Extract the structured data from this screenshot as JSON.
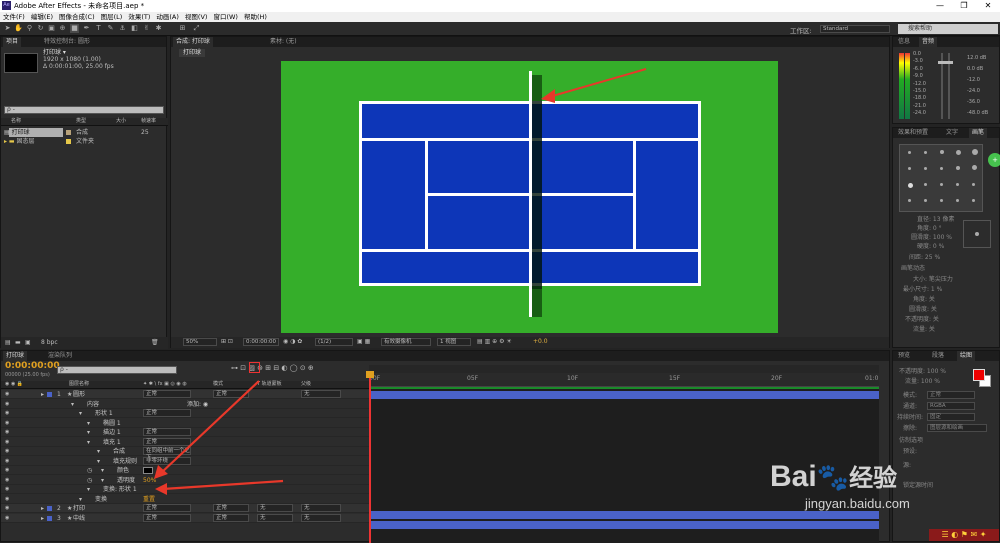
{
  "window": {
    "title": "Adobe After Effects - 未命名项目.aep *",
    "logo": "Ae",
    "min": "—",
    "max": "❐",
    "close": "✕"
  },
  "menu": [
    "文件(F)",
    "编辑(E)",
    "图像合成(C)",
    "图层(L)",
    "效果(T)",
    "动画(A)",
    "视图(V)",
    "窗口(W)",
    "帮助(H)"
  ],
  "toolbar": {
    "workspace_label": "工作区:",
    "workspace_value": "Standard",
    "search_placeholder": "搜索帮助"
  },
  "project": {
    "tabs": [
      "项目",
      "特效控制台: 圆形"
    ],
    "selected": "打印球 ▾",
    "info1": "1920 x 1080 (1.00)",
    "info2": "Δ 0:00:01:00, 25.00 fps",
    "search": "ρ -",
    "cols": [
      "名称",
      "类型",
      "大小",
      "帧速率"
    ],
    "items": [
      {
        "name": "打印球",
        "type": "合成",
        "size": "",
        "fps": "25",
        "color": "#b8a27a",
        "sel": true
      },
      {
        "name": "固态层",
        "type": "文件夹",
        "size": "",
        "fps": "",
        "color": "#e6c84a",
        "sel": false
      }
    ],
    "bpc": "8 bpc"
  },
  "comp": {
    "tabs": [
      "合成: 打印球",
      "素材: (无)"
    ],
    "subtab": "打印球",
    "zoom": "50%",
    "time": "0:00:00:00",
    "res": "(1/2)",
    "camera": "有效摄像机",
    "views": "1 视图",
    "offset": "+0.0"
  },
  "right": {
    "top_tabs": [
      "信息",
      "音频"
    ],
    "db_left": [
      "0.0",
      "-3.0",
      "-6.0",
      "-9.0",
      "-12.0",
      "-15.0",
      "-18.0",
      "-21.0",
      "-24.0"
    ],
    "db_right": [
      "12.0 dB",
      "0.0 dB",
      "-12.0",
      "-24.0",
      "-36.0",
      "-48.0 dB"
    ],
    "fx_tabs": [
      "效果和预置",
      "文字",
      "画笔"
    ],
    "brush": {
      "diameter": "直径: 13 像素",
      "angle": "角度: 0 °",
      "round": "圆滑度: 100 %",
      "hard": "硬度: 0 %",
      "spacing": "间距: 25 %",
      "dyn": "画笔动态",
      "size": "大小: 笔尖压力",
      "min": "最小尺寸: 1 %",
      "ang": "角度: 关",
      "rnd": "圆滑度: 关",
      "opa": "不透明度: 关",
      "flow": "流量: 关"
    },
    "paint_tabs": [
      "预览",
      "段落",
      "绘图"
    ],
    "paint": {
      "opacity": "不透明度: 100 %",
      "flow": "流量: 100 %",
      "mode": "模式:",
      "mode_val": "正常",
      "channel": "通道:",
      "channel_val": "RGBA",
      "dur": "持续时间:",
      "dur_val": "固定",
      "erase": "擦除:",
      "erase_val": "图层源和绘画",
      "clone": "仿制选项",
      "p1": "预设:",
      "src": "源:",
      "rgb": "锁定源时间"
    },
    "fg": "#ee0000",
    "bg": "#ffffff"
  },
  "timeline": {
    "tabs": [
      "打印球",
      "渲染队列"
    ],
    "timecode": "0:00:00:00",
    "fps": "00000 (25.00 fps)",
    "search": "ρ -",
    "cols": [
      "图层名称",
      "模式",
      "T 轨道蒙板",
      "父级"
    ],
    "ruler": [
      "00F",
      "05F",
      "10F",
      "15F",
      "20F",
      "01:0"
    ],
    "layers": [
      {
        "num": "1",
        "name": "圆形",
        "mode": "正常",
        "trk": "",
        "parent": "无",
        "color": "#4a62c8"
      },
      {
        "num": "",
        "name": "内容",
        "mode": "",
        "trk": "",
        "parent": "",
        "add": "添加: ◉",
        "color": ""
      },
      {
        "num": "",
        "name": "形状 1",
        "mode": "正常",
        "trk": "",
        "parent": "",
        "color": ""
      },
      {
        "num": "",
        "name": "椭圆 1",
        "mode": "",
        "trk": "",
        "parent": "",
        "color": ""
      },
      {
        "num": "",
        "name": "描边 1",
        "mode": "正常",
        "trk": "",
        "parent": "",
        "color": ""
      },
      {
        "num": "",
        "name": "填充 1",
        "mode": "正常",
        "trk": "",
        "parent": "",
        "color": ""
      },
      {
        "num": "",
        "name": "合成",
        "mode": "在同组中前一个之下",
        "trk": "",
        "parent": "",
        "color": ""
      },
      {
        "num": "",
        "name": "填充规则",
        "mode": "非零环绕",
        "trk": "",
        "parent": "",
        "color": ""
      },
      {
        "num": "",
        "name": "颜色",
        "mode": "",
        "trk": "",
        "parent": "",
        "color": ""
      },
      {
        "num": "",
        "name": "透明度",
        "mode": "",
        "val": "50%",
        "trk": "",
        "parent": "",
        "color": ""
      },
      {
        "num": "",
        "name": "变换: 形状 1",
        "mode": "",
        "trk": "",
        "parent": "",
        "color": ""
      },
      {
        "num": "",
        "name": "变换",
        "mode": "重置",
        "trk": "",
        "parent": "",
        "color": ""
      },
      {
        "num": "2",
        "name": "打印",
        "mode": "正常",
        "trk": "无",
        "parent": "无",
        "color": "#4a62c8"
      },
      {
        "num": "3",
        "name": "中线",
        "mode": "正常",
        "trk": "无",
        "parent": "无",
        "color": "#4a62c8"
      }
    ]
  },
  "watermark": {
    "brand": "Bai",
    "brand2": "经验",
    "url": "jingyan.baidu.com"
  }
}
